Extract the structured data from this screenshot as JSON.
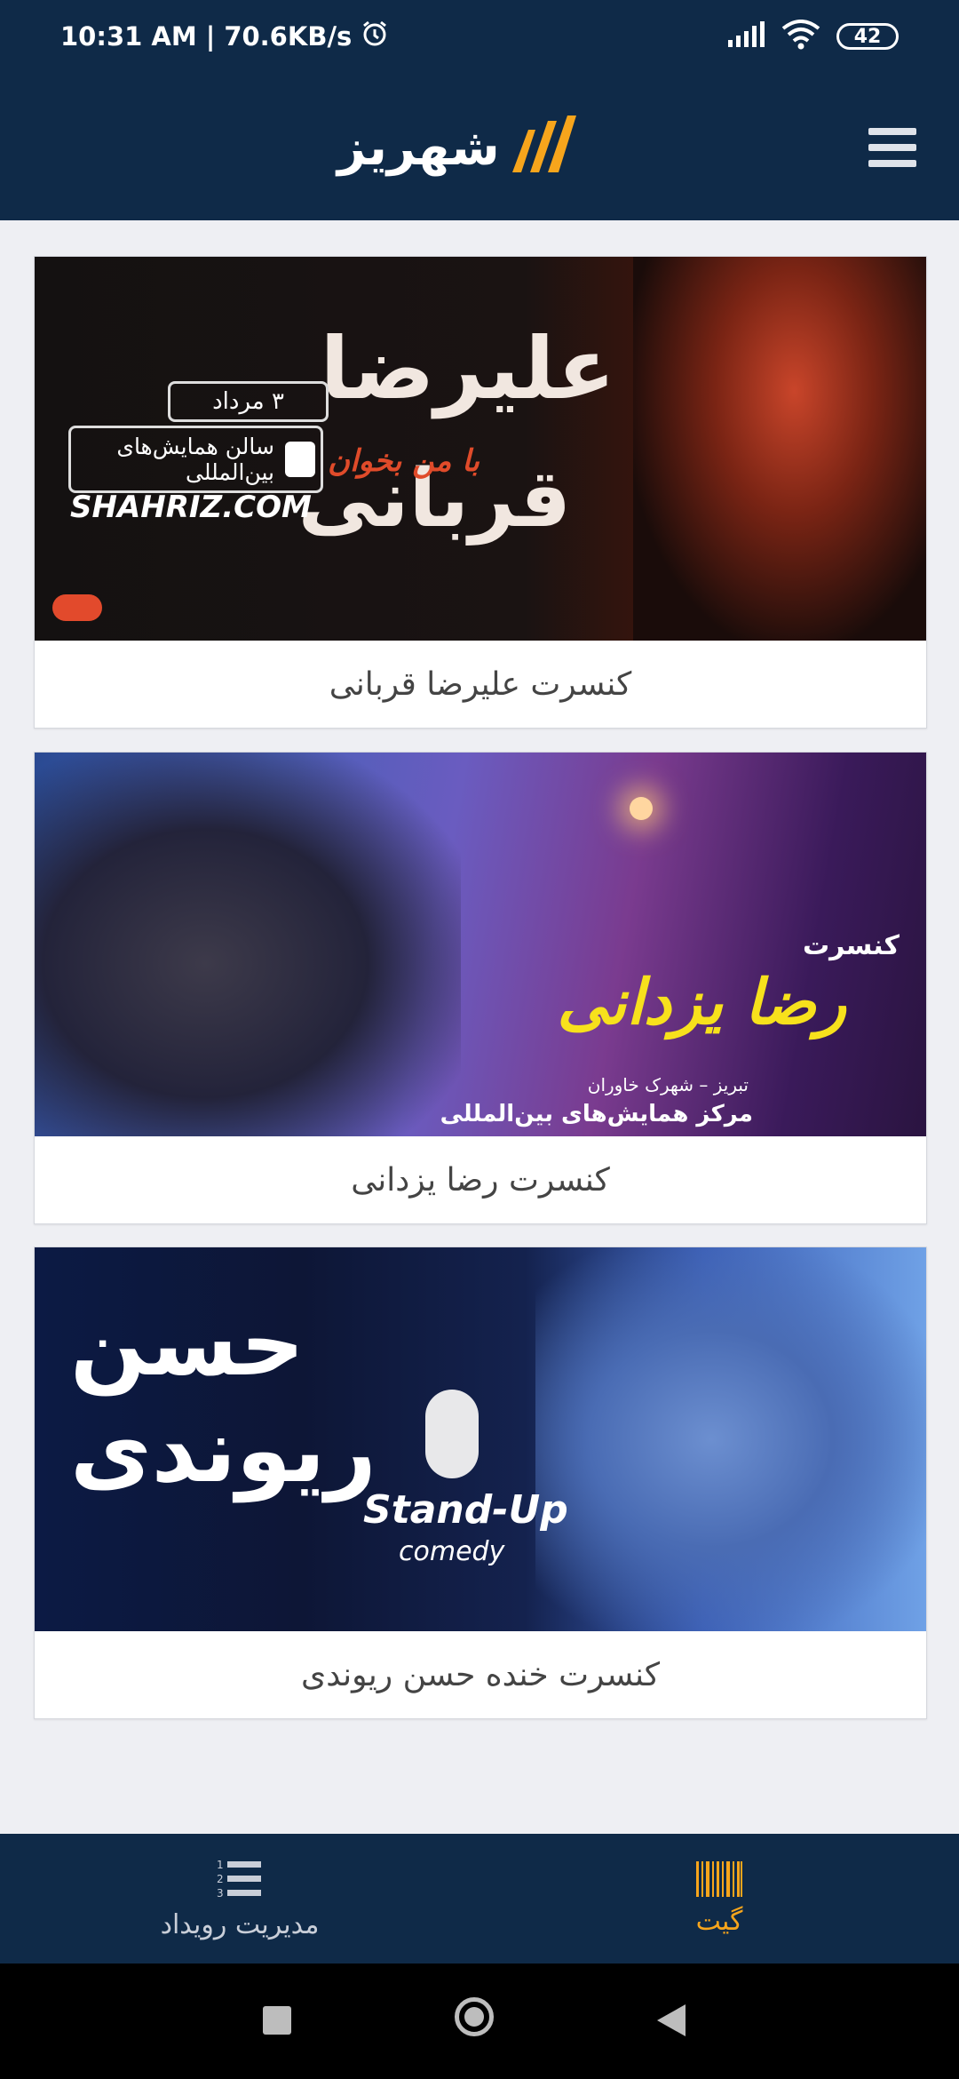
{
  "status_bar": {
    "time": "10:31 AM",
    "separator": "|",
    "net_speed": "70.6KB/s",
    "battery": "42"
  },
  "app_bar": {
    "logo_text": "شهریز",
    "brand_color": "#f7a51c"
  },
  "events": [
    {
      "title": "کنسرت علیرضا قربانی",
      "banner": {
        "name_line1": "علیرضا",
        "name_line2": "قربانی",
        "tag": "با من بخوان",
        "date": "۳ مرداد",
        "venue_line1": "سالن همایش‌های",
        "venue_line2": "بین‌المللی",
        "site": "SHAHRIZ.COM"
      }
    },
    {
      "title": "کنسرت رضا یزدانی",
      "banner": {
        "kicker": "کنسرت",
        "name": "رضا یزدانی",
        "city": "تبریز – شهرک خاوران",
        "venue": "مرکز همایش‌های بین‌المللی"
      }
    },
    {
      "title": "کنسرت خنده  حسن ریوندی",
      "banner": {
        "name_line1": "حسن",
        "name_line2": "ریوندی",
        "stand_up": "Stand-Up",
        "comedy": "comedy"
      }
    }
  ],
  "bottom_nav": {
    "items": [
      {
        "label": "مدیریت رویداد",
        "icon": "numbered-list-icon",
        "active": false
      },
      {
        "label": "گیت",
        "icon": "barcode-icon",
        "active": true
      }
    ],
    "active_color": "#f7a51c",
    "inactive_color": "#c9ced8"
  }
}
